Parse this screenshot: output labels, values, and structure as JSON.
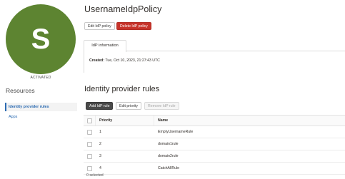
{
  "colors": {
    "avatar": "#5d8431",
    "danger": "#c7332a",
    "link": "#2c6bb2"
  },
  "avatar": {
    "letter": "S",
    "status": "ACTIVATED"
  },
  "sidebar": {
    "title": "Resources",
    "items": [
      {
        "label": "Identity provider rules",
        "active": true
      },
      {
        "label": "Apps",
        "active": false
      }
    ]
  },
  "header": {
    "title": "UsernameIdpPolicy",
    "edit_label": "Edit IdP policy",
    "delete_label": "Delete IdP policy"
  },
  "info": {
    "tab_label": "IdP information",
    "created_label": "Created:",
    "created_value": "Tue, Oct 10, 2023, 21:27:43 UTC"
  },
  "rules": {
    "title": "Identity provider rules",
    "add_label": "Add IdP rule",
    "edit_priority_label": "Edit priority",
    "remove_label": "Remove IdP rule",
    "columns": {
      "priority": "Priority",
      "name": "Name"
    },
    "rows": [
      {
        "priority": "1",
        "name": "EmptyUsernameRule"
      },
      {
        "priority": "2",
        "name": "domain1rule"
      },
      {
        "priority": "3",
        "name": "domain2rule"
      },
      {
        "priority": "4",
        "name": "CatchAllRule"
      }
    ],
    "selected_text": "0 selected"
  }
}
